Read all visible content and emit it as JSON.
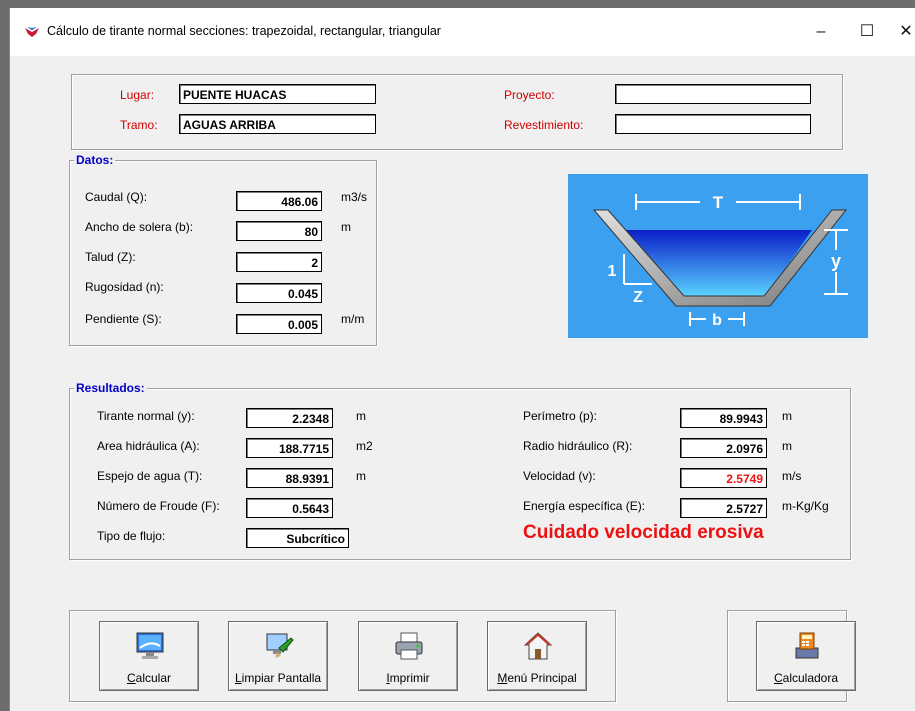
{
  "window": {
    "title": "Cálculo de tirante normal secciones: trapezoidal, rectangular, triangular",
    "minimize": "–",
    "maximize": "☐",
    "close": "✕"
  },
  "header": {
    "lugar_label": "Lugar:",
    "lugar_value": "PUENTE HUACAS",
    "tramo_label": "Tramo:",
    "tramo_value": "AGUAS ARRIBA",
    "proyecto_label": "Proyecto:",
    "proyecto_value": "",
    "revestimiento_label": "Revestimiento:",
    "revestimiento_value": ""
  },
  "datos": {
    "title": "Datos:",
    "caudal_label": "Caudal (Q):",
    "caudal_value": "486.06",
    "caudal_unit": "m3/s",
    "ancho_label": "Ancho de solera (b):",
    "ancho_value": "80",
    "ancho_unit": "m",
    "talud_label": "Talud (Z):",
    "talud_value": "2",
    "rugosidad_label": "Rugosidad (n):",
    "rugosidad_value": "0.045",
    "pendiente_label": "Pendiente (S):",
    "pendiente_value": "0.005",
    "pendiente_unit": "m/m"
  },
  "diagram": {
    "t": "T",
    "y": "y",
    "one": "1",
    "z": "Z",
    "b": "b"
  },
  "resultados": {
    "title": "Resultados:",
    "tirante_label": "Tirante normal (y):",
    "tirante_value": "2.2348",
    "tirante_unit": "m",
    "area_label": "Area hidráulica (A):",
    "area_value": "188.7715",
    "area_unit": "m2",
    "espejo_label": "Espejo de agua (T):",
    "espejo_value": "88.9391",
    "espejo_unit": "m",
    "froude_label": "Número de Froude (F):",
    "froude_value": "0.5643",
    "tipo_label": "Tipo de flujo:",
    "tipo_value": "Subcrítico",
    "perimetro_label": "Perímetro (p):",
    "perimetro_value": "89.9943",
    "perimetro_unit": "m",
    "radio_label": "Radio hidráulico (R):",
    "radio_value": "2.0976",
    "radio_unit": "m",
    "velocidad_label": "Velocidad (v):",
    "velocidad_value": "2.5749",
    "velocidad_unit": "m/s",
    "energia_label": "Energía específica (E):",
    "energia_value": "2.5727",
    "energia_unit": "m-Kg/Kg",
    "warning": "Cuidado velocidad erosiva"
  },
  "buttons": {
    "calcular": {
      "first": "C",
      "rest": "alcular"
    },
    "limpiar": {
      "first": "L",
      "rest": "impiar Pantalla"
    },
    "imprimir": {
      "first": "I",
      "rest": "mprimir"
    },
    "menu": {
      "first": "M",
      "rest": "enú Principal"
    },
    "calculadora": {
      "first": "C",
      "rest": "alculadora"
    }
  },
  "colors": {
    "accent_label": "#d00000",
    "group_title": "#0000c8",
    "warning": "#ee1111",
    "diagram_bg": "#3ca0f0"
  }
}
